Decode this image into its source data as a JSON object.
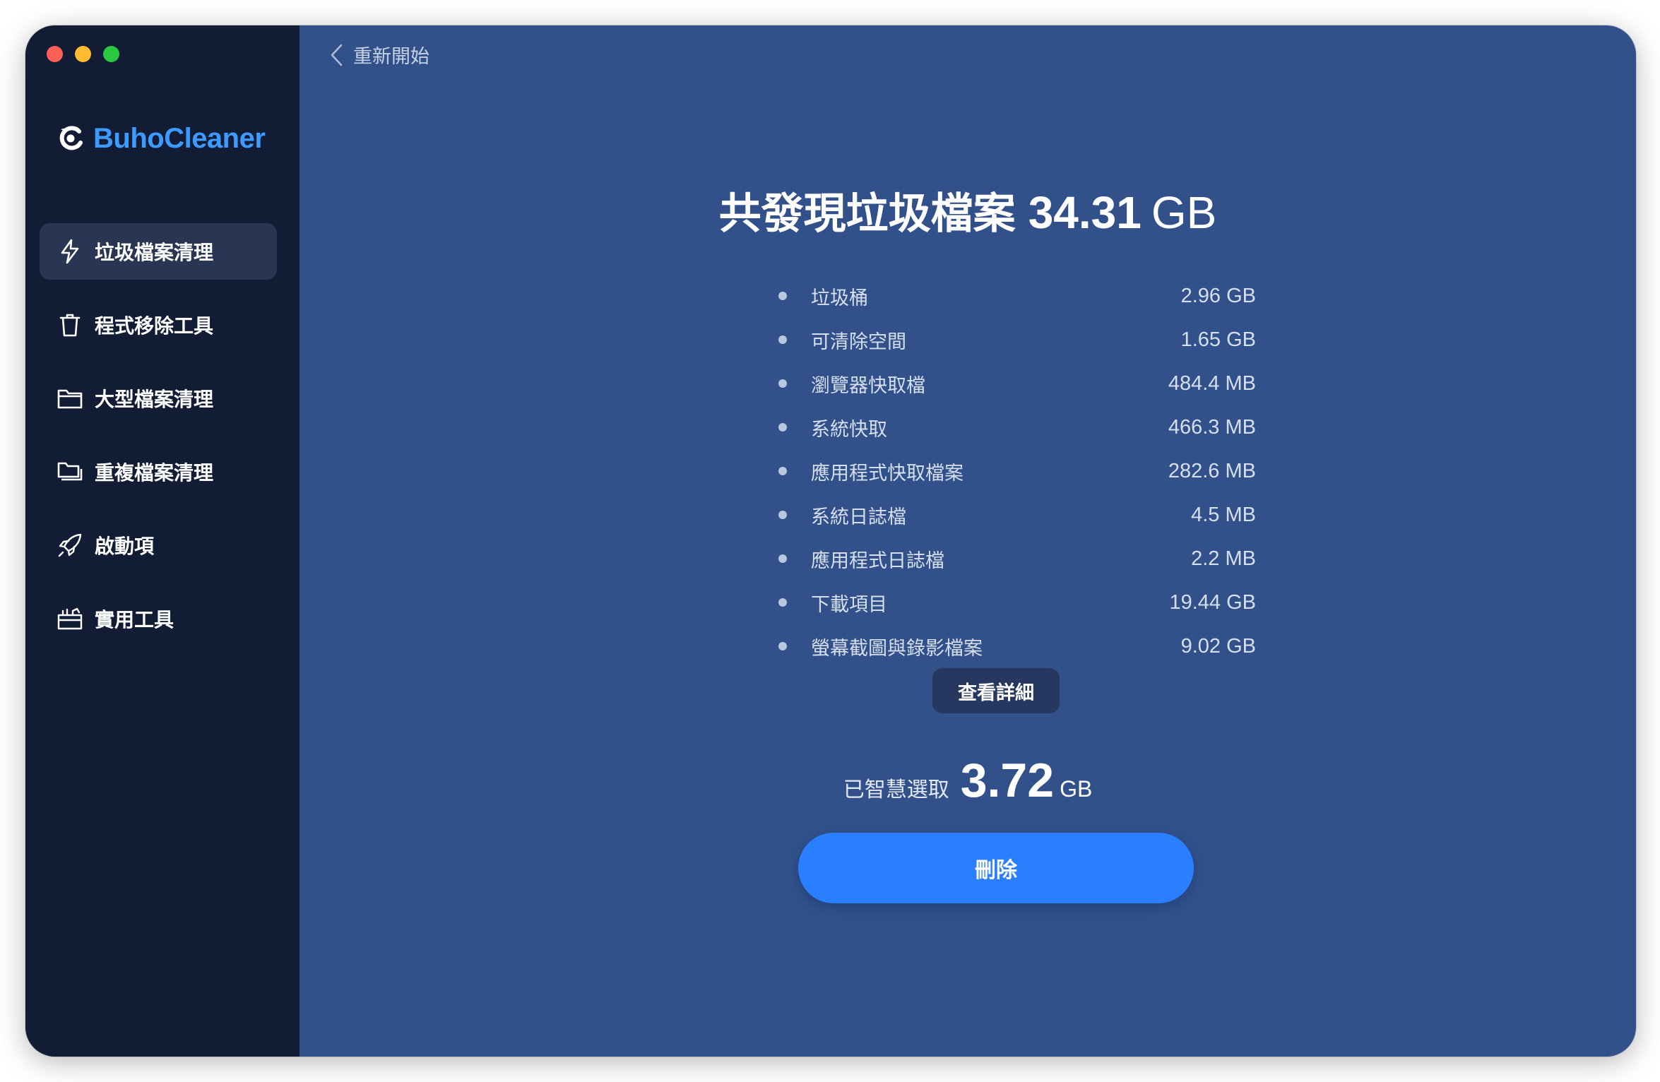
{
  "app": {
    "name": "BuhoCleaner",
    "brand_color": "#3d9bff"
  },
  "window_controls": [
    "close",
    "minimize",
    "zoom"
  ],
  "sidebar": {
    "items": [
      {
        "label": "垃圾檔案清理",
        "icon": "lightning-icon",
        "active": true
      },
      {
        "label": "程式移除工具",
        "icon": "trash-icon",
        "active": false
      },
      {
        "label": "大型檔案清理",
        "icon": "folder-icon",
        "active": false
      },
      {
        "label": "重複檔案清理",
        "icon": "duplicate-folder-icon",
        "active": false
      },
      {
        "label": "啟動項",
        "icon": "rocket-icon",
        "active": false
      },
      {
        "label": "實用工具",
        "icon": "toolbox-icon",
        "active": false
      }
    ]
  },
  "header": {
    "back_label": "重新開始"
  },
  "summary": {
    "title_text": "共發現垃圾檔案",
    "total_value": "34.31",
    "total_unit": "GB"
  },
  "items": [
    {
      "label": "垃圾桶",
      "size": "2.96 GB"
    },
    {
      "label": "可清除空間",
      "size": "1.65 GB"
    },
    {
      "label": "瀏覽器快取檔",
      "size": "484.4 MB"
    },
    {
      "label": "系統快取",
      "size": "466.3 MB"
    },
    {
      "label": "應用程式快取檔案",
      "size": "282.6 MB"
    },
    {
      "label": "系統日誌檔",
      "size": "4.5 MB"
    },
    {
      "label": "應用程式日誌檔",
      "size": "2.2 MB"
    },
    {
      "label": "下載項目",
      "size": "19.44 GB"
    },
    {
      "label": "螢幕截圖與錄影檔案",
      "size": "9.02 GB"
    }
  ],
  "details_button": "查看詳細",
  "selection": {
    "label": "已智慧選取",
    "value": "3.72",
    "unit": "GB"
  },
  "delete_button": "刪除",
  "colors": {
    "sidebar_bg": "#121c35",
    "main_bg": "#32518a",
    "primary_button": "#2a7fff"
  }
}
